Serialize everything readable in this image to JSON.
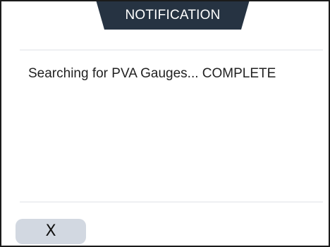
{
  "dialog": {
    "title": "NOTIFICATION",
    "message": "Searching for PVA Gauges... COMPLETE",
    "close_label": "X"
  },
  "colors": {
    "title_tab_bg": "#263342",
    "title_text": "#ffffff",
    "close_button_bg": "#d2d8e1",
    "divider": "#eef0f2"
  }
}
